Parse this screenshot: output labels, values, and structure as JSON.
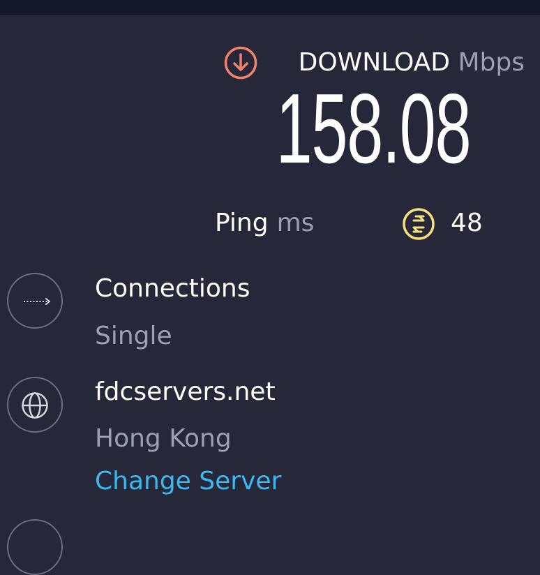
{
  "download": {
    "label": "DOWNLOAD",
    "unit": "Mbps",
    "value": "158.08",
    "icon": "download-arrow-icon",
    "icon_color": "#f0846a"
  },
  "ping": {
    "label": "Ping",
    "unit": "ms",
    "value": "48",
    "icon": "ping-arrows-icon",
    "icon_color": "#f6e27a"
  },
  "connections": {
    "title": "Connections",
    "value": "Single",
    "icon": "dotted-arrow-icon"
  },
  "server": {
    "name": "fdcservers.net",
    "location": "Hong Kong",
    "change_label": "Change Server",
    "icon": "globe-icon"
  },
  "colors": {
    "background": "#262839",
    "muted_text": "#9d9fb3",
    "link": "#3cb8f0"
  }
}
